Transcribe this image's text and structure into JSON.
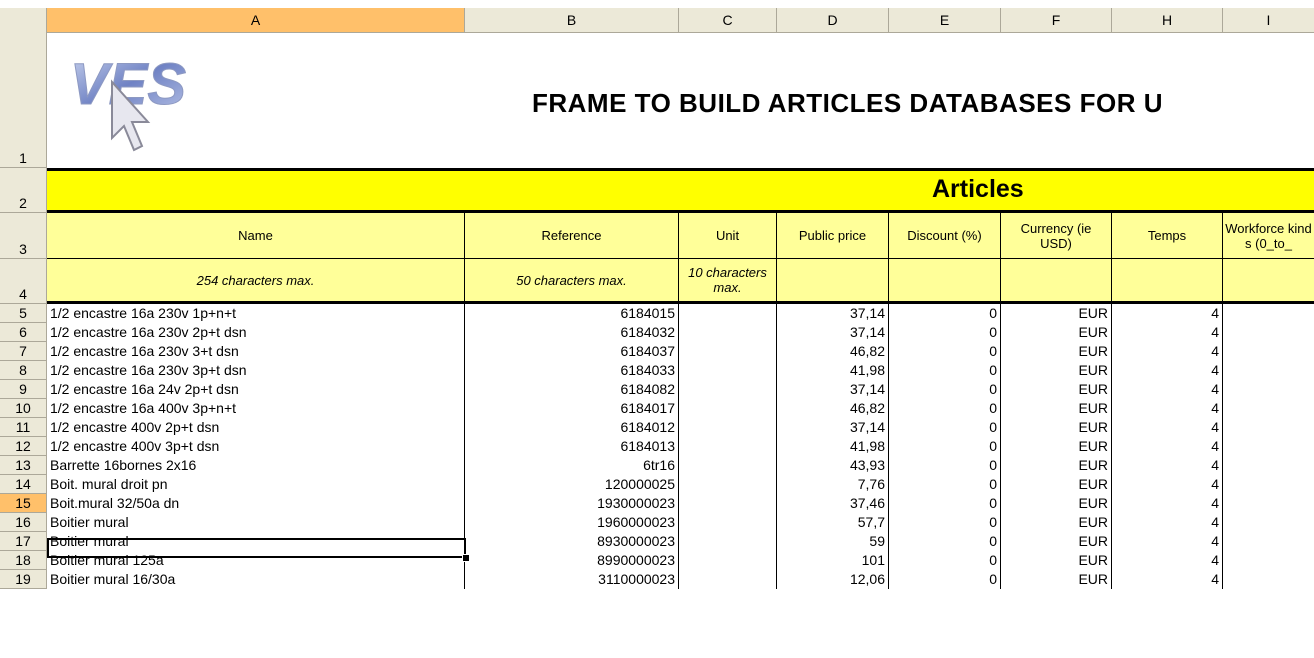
{
  "columns": [
    "A",
    "B",
    "C",
    "D",
    "E",
    "F",
    "H",
    "I"
  ],
  "active_column": "A",
  "rows": [
    "1",
    "2",
    "3",
    "4",
    "5",
    "6",
    "7",
    "8",
    "9",
    "10",
    "11",
    "12",
    "13",
    "14",
    "15",
    "16",
    "17",
    "18",
    "19"
  ],
  "active_row": "15",
  "logo_text": "VES",
  "title": "FRAME TO BUILD ARTICLES DATABASES FOR U",
  "band_title": "Articles",
  "headers": {
    "name": "Name",
    "reference": "Reference",
    "unit": "Unit",
    "public_price": "Public price",
    "discount": "Discount (%)",
    "currency": "Currency (ie USD)",
    "temps": "Temps",
    "workforce": "Workforce kinds (0_to_"
  },
  "constraints": {
    "name": "254 characters max.",
    "reference": "50 characters max.",
    "unit": "10 characters max."
  },
  "table": [
    {
      "name": "1/2 encastre 16a 230v 1p+n+t",
      "ref": "6184015",
      "unit": "",
      "price": "37,14",
      "disc": "0",
      "cur": "EUR",
      "temps": "4"
    },
    {
      "name": "1/2 encastre 16a 230v 2p+t dsn",
      "ref": "6184032",
      "unit": "",
      "price": "37,14",
      "disc": "0",
      "cur": "EUR",
      "temps": "4"
    },
    {
      "name": "1/2 encastre 16a 230v 3+t dsn",
      "ref": "6184037",
      "unit": "",
      "price": "46,82",
      "disc": "0",
      "cur": "EUR",
      "temps": "4"
    },
    {
      "name": "1/2 encastre 16a 230v 3p+t dsn",
      "ref": "6184033",
      "unit": "",
      "price": "41,98",
      "disc": "0",
      "cur": "EUR",
      "temps": "4"
    },
    {
      "name": "1/2 encastre 16a 24v 2p+t dsn",
      "ref": "6184082",
      "unit": "",
      "price": "37,14",
      "disc": "0",
      "cur": "EUR",
      "temps": "4"
    },
    {
      "name": "1/2 encastre 16a 400v 3p+n+t",
      "ref": "6184017",
      "unit": "",
      "price": "46,82",
      "disc": "0",
      "cur": "EUR",
      "temps": "4"
    },
    {
      "name": "1/2 encastre 400v 2p+t dsn",
      "ref": "6184012",
      "unit": "",
      "price": "37,14",
      "disc": "0",
      "cur": "EUR",
      "temps": "4"
    },
    {
      "name": "1/2 encastre 400v 3p+t dsn",
      "ref": "6184013",
      "unit": "",
      "price": "41,98",
      "disc": "0",
      "cur": "EUR",
      "temps": "4"
    },
    {
      "name": "Barrette 16bornes 2x16",
      "ref": "6tr16",
      "unit": "",
      "price": "43,93",
      "disc": "0",
      "cur": "EUR",
      "temps": "4"
    },
    {
      "name": "Boit. mural droit pn",
      "ref": "120000025",
      "unit": "",
      "price": "7,76",
      "disc": "0",
      "cur": "EUR",
      "temps": "4"
    },
    {
      "name": "Boit.mural 32/50a dn",
      "ref": "1930000023",
      "unit": "",
      "price": "37,46",
      "disc": "0",
      "cur": "EUR",
      "temps": "4"
    },
    {
      "name": "Boitier mural",
      "ref": "1960000023",
      "unit": "",
      "price": "57,7",
      "disc": "0",
      "cur": "EUR",
      "temps": "4"
    },
    {
      "name": "Boitier mural",
      "ref": "8930000023",
      "unit": "",
      "price": "59",
      "disc": "0",
      "cur": "EUR",
      "temps": "4"
    },
    {
      "name": "Boitier mural 125a",
      "ref": "8990000023",
      "unit": "",
      "price": "101",
      "disc": "0",
      "cur": "EUR",
      "temps": "4"
    },
    {
      "name": "Boitier mural 16/30a",
      "ref": "3110000023",
      "unit": "",
      "price": "12,06",
      "disc": "0",
      "cur": "EUR",
      "temps": "4"
    }
  ],
  "colors": {
    "band": "#ffff00",
    "header_fill": "#ffff99",
    "active_header": "#ffc06a",
    "grid_header": "#ece9d8"
  }
}
